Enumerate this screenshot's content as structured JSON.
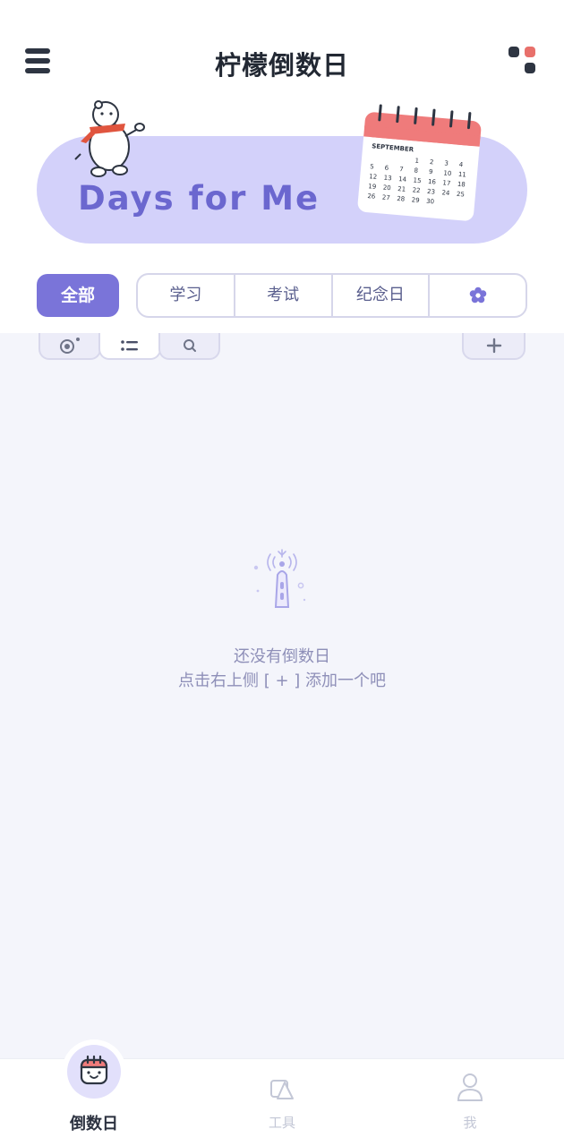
{
  "header": {
    "title": "柠檬倒数日",
    "menu_icon": "hamburger-menu-icon",
    "apps_icon": "dots-grid-icon",
    "dot_colors": [
      "#2e3542",
      "#e8706b",
      "#2e3542"
    ]
  },
  "banner": {
    "title": "Days for Me",
    "calendar": {
      "month": "SEPTEMBER",
      "rows": [
        [
          "",
          "",
          "",
          "1",
          "2",
          "3",
          "4"
        ],
        [
          "5",
          "6",
          "7",
          "8",
          "9",
          "10",
          "11"
        ],
        [
          "12",
          "13",
          "14",
          "15",
          "16",
          "17",
          "18"
        ],
        [
          "19",
          "20",
          "21",
          "22",
          "23",
          "24",
          "25"
        ],
        [
          "26",
          "27",
          "28",
          "29",
          "30",
          "",
          ""
        ]
      ]
    },
    "colors": {
      "banner": "#d3d1fa",
      "title": "#6b67cf",
      "calendar_top": "#ef7b7b"
    }
  },
  "categories": {
    "active": "全部",
    "items": [
      "学习",
      "考试",
      "纪念日"
    ],
    "settings_icon": "gear-icon"
  },
  "toolbar": {
    "icons": [
      "target-icon",
      "list-icon",
      "search-icon"
    ],
    "add_icon": "plus-icon"
  },
  "empty_state": {
    "icon": "signal-tower-icon",
    "line1": "还没有倒数日",
    "line2": "点击右上侧 [ + ] 添加一个吧"
  },
  "bottom_nav": {
    "items": [
      {
        "label": "倒数日",
        "icon": "calendar-face-icon",
        "active": true
      },
      {
        "label": "工具",
        "icon": "tool-icon",
        "active": false
      },
      {
        "label": "我",
        "icon": "person-icon",
        "active": false
      }
    ]
  },
  "colors": {
    "accent": "#7a74d9",
    "background": "#f4f5fb",
    "muted_text": "#8e8fb8"
  }
}
